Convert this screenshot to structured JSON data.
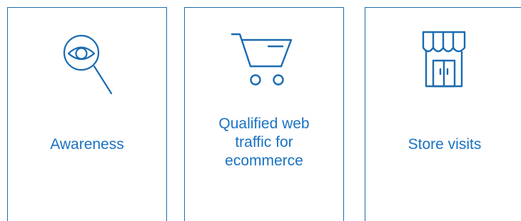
{
  "colors": {
    "border": "#1b6bb0",
    "icon": "#1b6bb0",
    "label": "#1a72c2",
    "background": "#ffffff"
  },
  "cards": [
    {
      "icon": "search-eye-icon",
      "label": "Awareness"
    },
    {
      "icon": "shopping-cart-icon",
      "label_lines": [
        "Qualified web",
        "traffic for",
        "ecommerce"
      ]
    },
    {
      "icon": "storefront-icon",
      "label": "Store visits"
    }
  ]
}
